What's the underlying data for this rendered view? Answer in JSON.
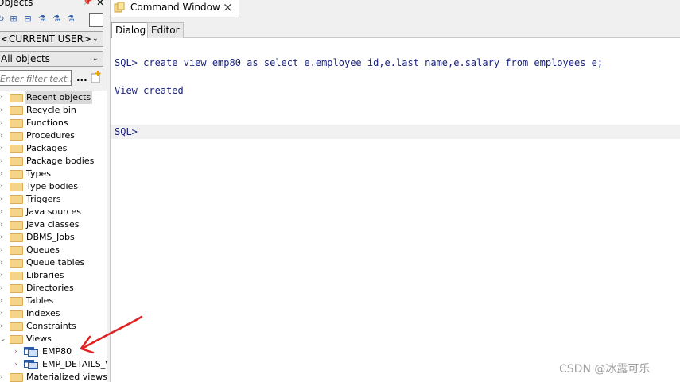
{
  "left_panel": {
    "title": "Objects",
    "user_combo": "<CURRENT USER>",
    "type_combo": "All objects",
    "filter_placeholder": "Enter filter text...",
    "filter_button": "...",
    "tree_items": [
      {
        "label": "Recent objects",
        "selected": true
      },
      {
        "label": "Recycle bin"
      },
      {
        "label": "Functions"
      },
      {
        "label": "Procedures"
      },
      {
        "label": "Packages"
      },
      {
        "label": "Package bodies"
      },
      {
        "label": "Types"
      },
      {
        "label": "Type bodies"
      },
      {
        "label": "Triggers"
      },
      {
        "label": "Java sources"
      },
      {
        "label": "Java classes"
      },
      {
        "label": "DBMS_Jobs"
      },
      {
        "label": "Queues"
      },
      {
        "label": "Queue tables"
      },
      {
        "label": "Libraries"
      },
      {
        "label": "Directories"
      },
      {
        "label": "Tables"
      },
      {
        "label": "Indexes"
      },
      {
        "label": "Constraints"
      },
      {
        "label": "Views",
        "expanded": true
      }
    ],
    "view_items": [
      {
        "label": "EMP80"
      },
      {
        "label": "EMP_DETAILS_VIEW"
      }
    ],
    "after_views": {
      "label": "Materialized views"
    }
  },
  "command_window": {
    "tab_title": "Command Window",
    "close": "×",
    "sub_tabs": [
      "Dialog",
      "Editor"
    ],
    "lines": [
      "SQL> create view emp80 as select e.employee_id,e.last_name,e.salary from employees e;",
      "View created",
      "SQL>"
    ]
  },
  "watermark": "CSDN @冰露可乐",
  "colors": {
    "sql_text": "#1a237e",
    "folder": "#f5d38a",
    "annotation_arrow": "#e02020"
  }
}
